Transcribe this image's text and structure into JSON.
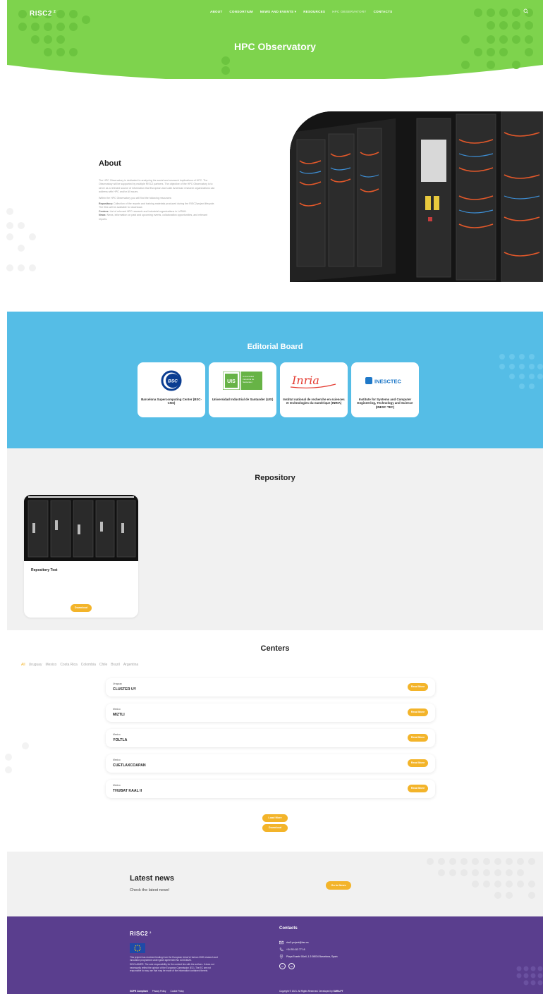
{
  "header": {
    "logo": "RISC2",
    "logo_sup": "2",
    "nav": [
      "ABOUT",
      "CONSORTIUM",
      "NEWS AND EVENTS",
      "RESOURCES",
      "HPC OBSERVATORY",
      "CONTACTS"
    ],
    "nav_active_index": 4,
    "page_title": "HPC Observatory",
    "colors": {
      "hero": "#7ed34d",
      "hero_dots": "#5fba35",
      "accent": "#f3b42a"
    }
  },
  "about": {
    "title": "About",
    "p1": "The HPC Observatory is dedicated to analyzing the social and research implications of HPC. The Observatory will be supported by multiple RISC2 partners. The objective of the HPC Observatory is to serve as a relevant source of information that European and Latin American research organizations can address with HPC and/or AI issues.",
    "p2": "Within the HPC Observatory you will find the following resources:",
    "items": [
      {
        "label": "Repository:",
        "text": "Collection of the reports and training materials produced during the RISC2project lifecycle. The files will be available for download."
      },
      {
        "label": "Centers:",
        "text": "List of relevant HPC research and industrial organisations in LATAM."
      },
      {
        "label": "News:",
        "text": "News, information on past and upcoming events, collaboration opportunities, and relevant reports."
      }
    ]
  },
  "board": {
    "title": "Editorial Board",
    "color": "#55bde6",
    "cards": [
      {
        "logo_text": "BSC",
        "caption": "Barcelona Supercomputing Center (BSC-CNS)"
      },
      {
        "logo_text": "UIS",
        "logo_side": "Universidad Industrial de Santander",
        "caption": "Universidad Industrial de Santander (UIS)"
      },
      {
        "logo_text": "Inria",
        "caption": "Institut national de recherche en sciences et technologies du numérique (INRIA)"
      },
      {
        "logo_text": "INESCTEC",
        "caption": "Institute for Systems and Computer Engineering, Technology and Science (INESC TEC)"
      }
    ]
  },
  "repository": {
    "title": "Repository",
    "card_title": "Repository Test",
    "download": "Download"
  },
  "centers": {
    "title": "Centers",
    "filters": [
      "All",
      "Uruguay",
      "Mexico",
      "Costa Rica",
      "Colombia",
      "Chile",
      "Brazil",
      "Argentina"
    ],
    "active_filter": "All",
    "rows": [
      {
        "country": "Uruguay",
        "name": "CLUSTER UY"
      },
      {
        "country": "Mexico",
        "name": "MIZTLI"
      },
      {
        "country": "Mexico",
        "name": "YOLTLA"
      },
      {
        "country": "Mexico",
        "name": "CUETLAXCOAPAN"
      },
      {
        "country": "Mexico",
        "name": "THUBAT KAAL II"
      }
    ],
    "read_more": "Read More",
    "load_more": "Load More",
    "download": "Download"
  },
  "news": {
    "title": "Latest news",
    "subtitle": "Check the latest news!",
    "button": "Go to News"
  },
  "footer": {
    "logo": "RISC2",
    "logo_sup": "2",
    "funding": "This project has received funding from the European Union's Horizon 2020 research and innovation programme under grant agreement No 101016426.",
    "disclaimer": "DISCLAIMER: The sole responsibility for the content lies with the authors. It does not necessarily reflect the opinion of the European Commission (EC). The EC are not responsible for any use that may be made of the information contained therein.",
    "links": [
      "GDPR Compliant",
      "Privacy Policy",
      "Cookie Policy"
    ],
    "contacts_title": "Contacts",
    "email": "risc2-project@bsc.es",
    "phone": "+34 93 413 77 16",
    "address": "Plaça Eusebi Güell, 1-3 08034 Barcelona, Spain",
    "social": [
      "in",
      "tw"
    ],
    "copyright": "Copyright © 2021. All Rights Reserved. Developed by",
    "developer": "SURA.PT",
    "color": "#5a3e8e"
  }
}
